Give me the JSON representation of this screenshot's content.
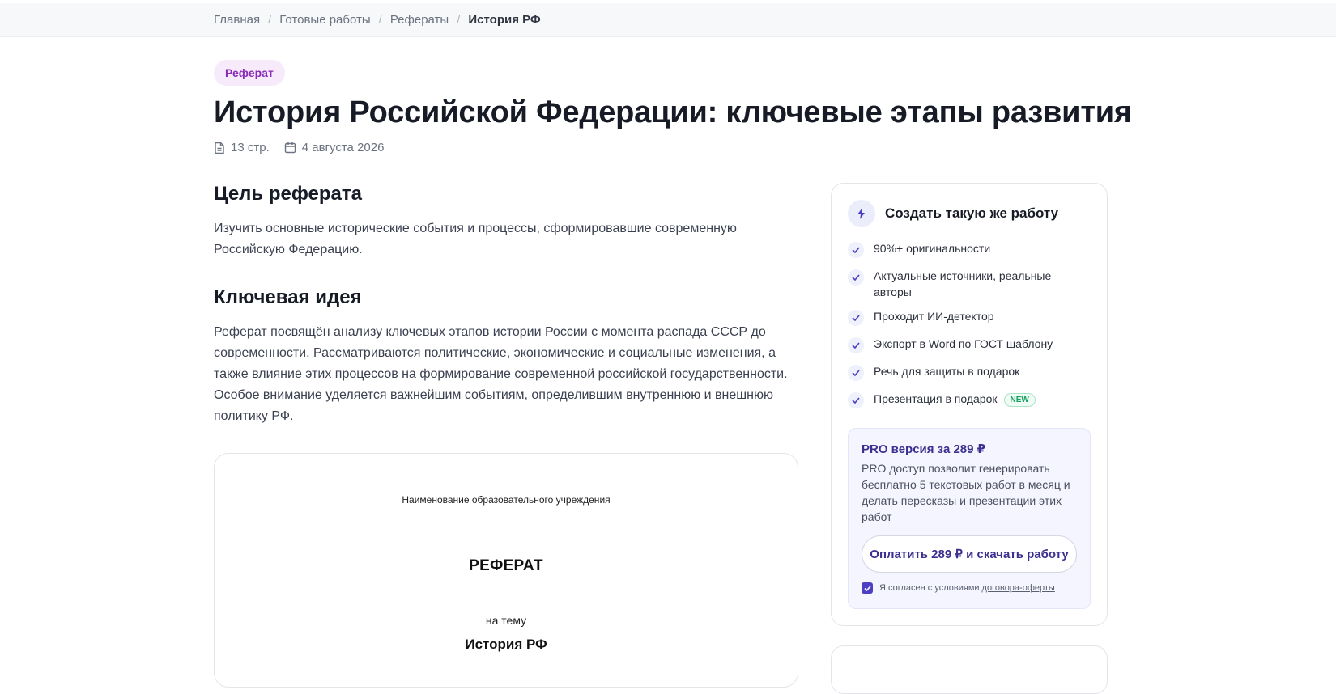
{
  "breadcrumb": {
    "items": [
      "Главная",
      "Готовые работы",
      "Рефераты"
    ],
    "current": "История РФ",
    "separator": "/"
  },
  "work": {
    "type_tag": "Реферат",
    "title": "История Российской Федерации: ключевые этапы развития",
    "pages": "13 стр.",
    "date": "4 августа 2026"
  },
  "sections": {
    "goal_heading": "Цель реферата",
    "goal_text": "Изучить основные исторические события и процессы, сформировавшие современную Российскую Федерацию.",
    "idea_heading": "Ключевая идея",
    "idea_text": "Реферат посвящён анализу ключевых этапов истории России с момента распада СССР до современности. Рассматриваются политические, экономические и социальные изменения, а также влияние этих процессов на формирование современной российской государственности. Особое внимание уделяется важнейшим событиям, определившим внутреннюю и внешнюю политику РФ."
  },
  "preview": {
    "institution": "Наименование образовательного учреждения",
    "kind": "РЕФЕРАТ",
    "on_topic": "на тему",
    "topic": "История РФ"
  },
  "order_card": {
    "title": "Создать такую же работу",
    "features": [
      "90%+ оригинальности",
      "Актуальные источники, реальные авторы",
      "Проходит ИИ-детектор",
      "Экспорт в Word по ГОСТ шаблону",
      "Речь для защиты в подарок",
      "Презентация в подарок"
    ],
    "new_badge": "NEW",
    "pro_title": "PRO версия за 289 ₽",
    "pro_text": "PRO доступ позволит генерировать бесплатно 5 текстовых работ в месяц и делать пересказы и презентации этих работ",
    "pay_button": "Оплатить 289 ₽ и скачать работу",
    "agree_text": "Я согласен с условиями",
    "agree_link": "договора-оферты",
    "agree_checked": true
  },
  "colors": {
    "accent": "#4d3fc4",
    "tag_bg": "#f6eafb",
    "tag_text": "#8a2bb6",
    "new_badge": "#12a05c"
  }
}
